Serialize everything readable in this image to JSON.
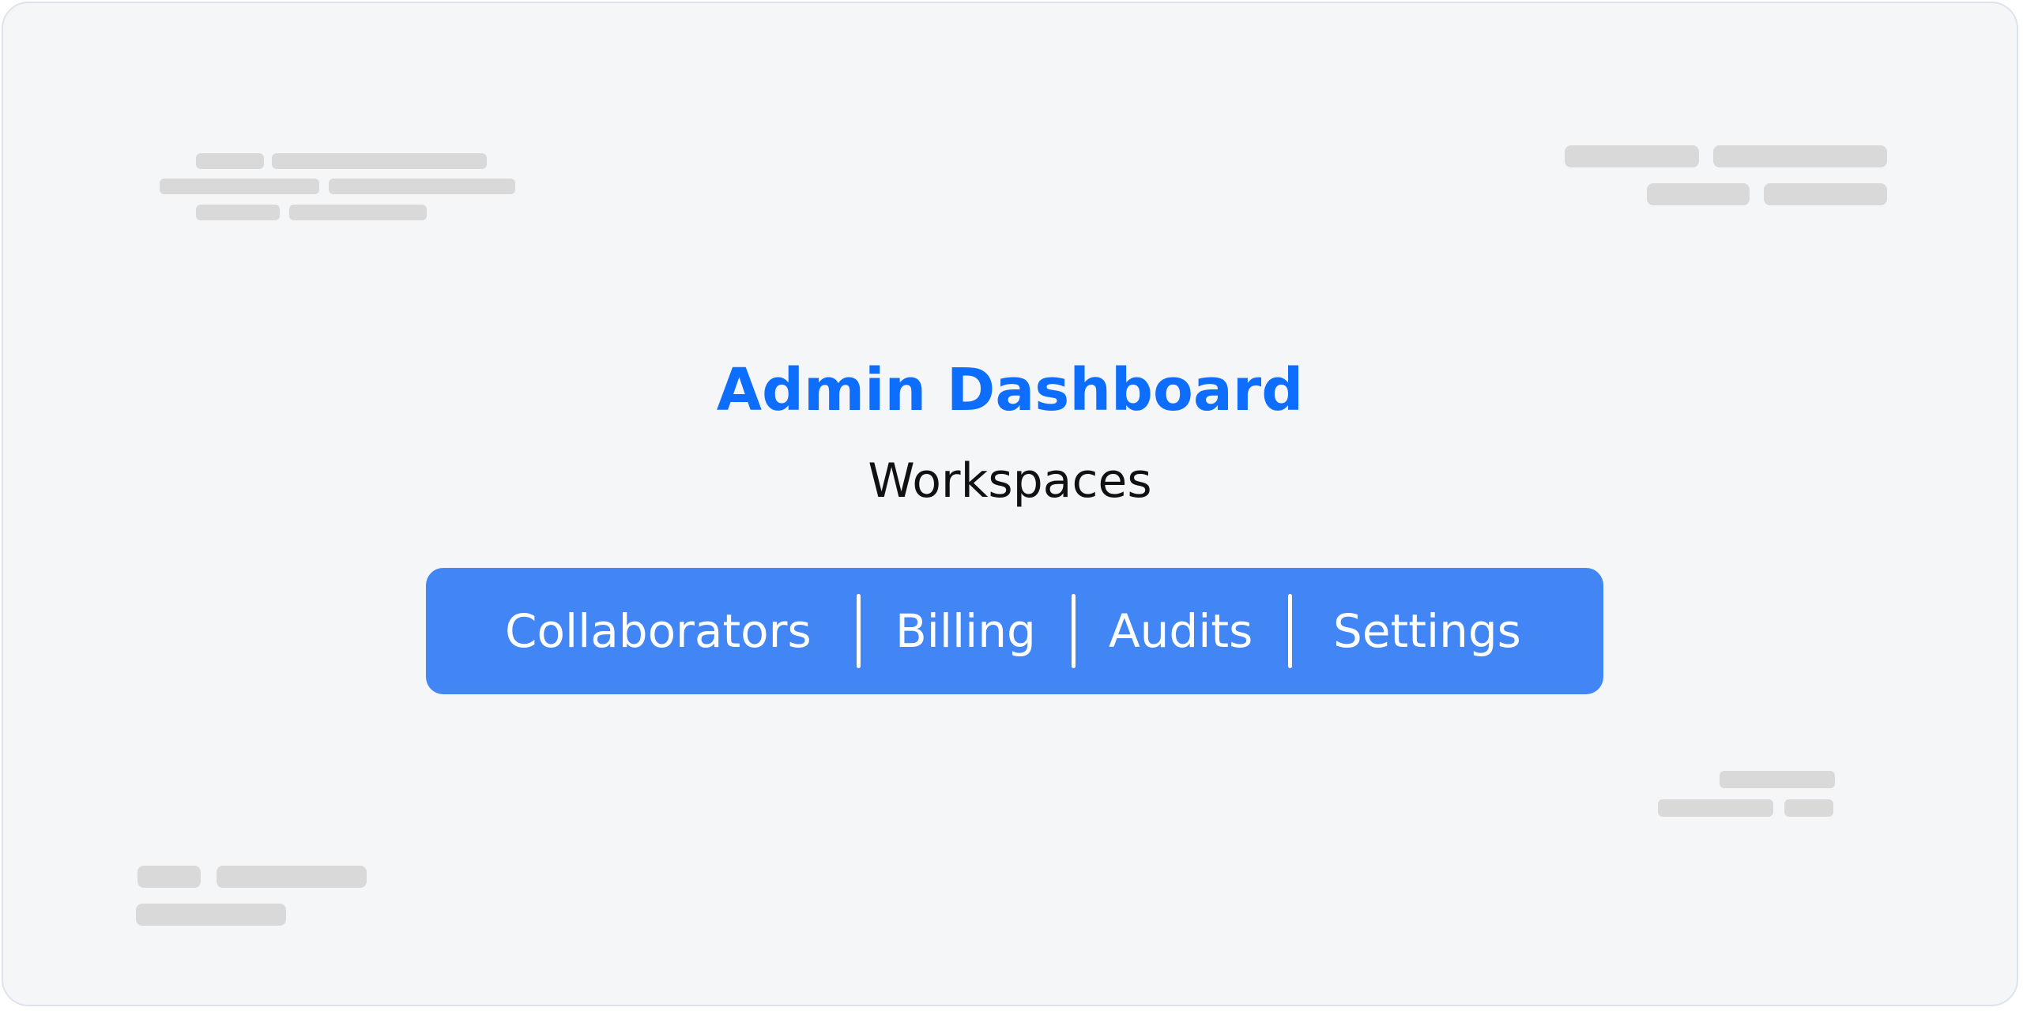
{
  "header": {
    "title": "Admin Dashboard",
    "subtitle": "Workspaces"
  },
  "nav": {
    "items": [
      {
        "label": "Collaborators"
      },
      {
        "label": "Billing"
      },
      {
        "label": "Audits"
      },
      {
        "label": "Settings"
      }
    ]
  },
  "colors": {
    "accent": "#0d6efd",
    "nav_background": "#4285f4",
    "page_background": "#f5f6f8",
    "placeholder": "#d9d9d9"
  }
}
